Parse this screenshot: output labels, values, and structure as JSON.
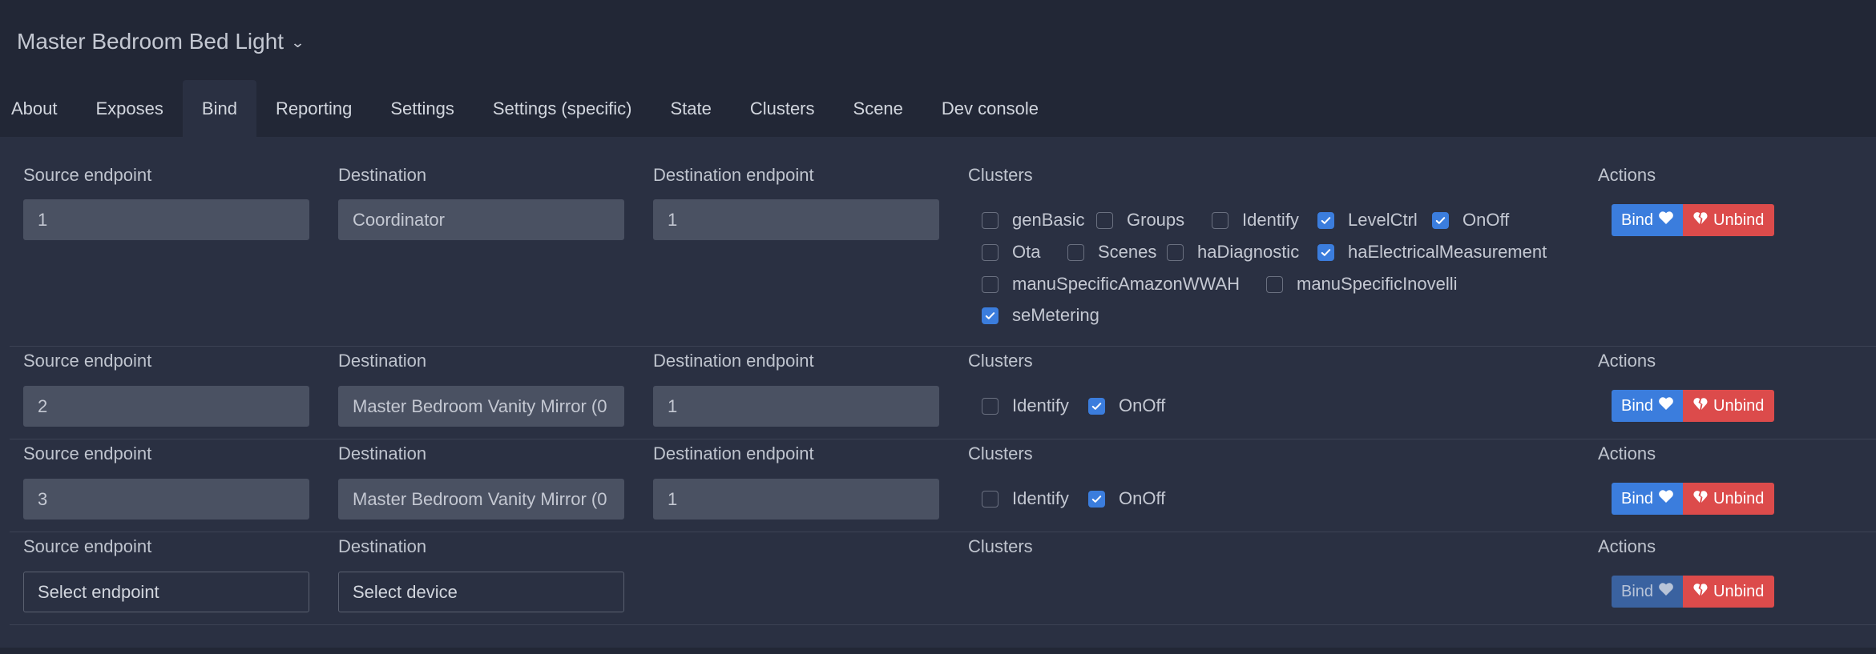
{
  "header": {
    "device_name": "Master Bedroom Bed Light",
    "dropdown_icon": "chevron-down-icon"
  },
  "tabs": [
    {
      "label": "About",
      "active": false
    },
    {
      "label": "Exposes",
      "active": false
    },
    {
      "label": "Bind",
      "active": true
    },
    {
      "label": "Reporting",
      "active": false
    },
    {
      "label": "Settings",
      "active": false
    },
    {
      "label": "Settings (specific)",
      "active": false
    },
    {
      "label": "State",
      "active": false
    },
    {
      "label": "Clusters",
      "active": false
    },
    {
      "label": "Scene",
      "active": false
    },
    {
      "label": "Dev console",
      "active": false
    }
  ],
  "labels": {
    "source_endpoint": "Source endpoint",
    "destination": "Destination",
    "destination_endpoint": "Destination endpoint",
    "clusters": "Clusters",
    "actions": "Actions",
    "bind": "Bind",
    "unbind": "Unbind"
  },
  "rules": [
    {
      "source_endpoint": "1",
      "destination": "Coordinator",
      "destination_endpoint": "1",
      "clusters": [
        {
          "name": "genBasic",
          "checked": false
        },
        {
          "name": "Groups",
          "checked": false
        },
        {
          "name": "Identify",
          "checked": false
        },
        {
          "name": "LevelCtrl",
          "checked": true
        },
        {
          "name": "OnOff",
          "checked": true
        },
        {
          "name": "Ota",
          "checked": false
        },
        {
          "name": "Scenes",
          "checked": false
        },
        {
          "name": "haDiagnostic",
          "checked": false
        },
        {
          "name": "haElectricalMeasurement",
          "checked": true
        },
        {
          "name": "manuSpecificAmazonWWAH",
          "checked": false
        },
        {
          "name": "manuSpecificInovelli",
          "checked": false
        },
        {
          "name": "seMetering",
          "checked": true
        }
      ]
    },
    {
      "source_endpoint": "2",
      "destination": "Master Bedroom Vanity Mirror (0",
      "destination_endpoint": "1",
      "clusters": [
        {
          "name": "Identify",
          "checked": false
        },
        {
          "name": "OnOff",
          "checked": true
        }
      ]
    },
    {
      "source_endpoint": "3",
      "destination": "Master Bedroom Vanity Mirror (0",
      "destination_endpoint": "1",
      "clusters": [
        {
          "name": "Identify",
          "checked": false
        },
        {
          "name": "OnOff",
          "checked": true
        }
      ]
    }
  ],
  "new_rule": {
    "source_placeholder": "Select endpoint",
    "destination_placeholder": "Select device",
    "bind_disabled": true
  },
  "colors": {
    "background": "#222736",
    "panel": "#2a3042",
    "bind_button": "#3b7ddd",
    "unbind_button": "#dc4b4b",
    "checkbox_checked": "#3b7ddd"
  }
}
